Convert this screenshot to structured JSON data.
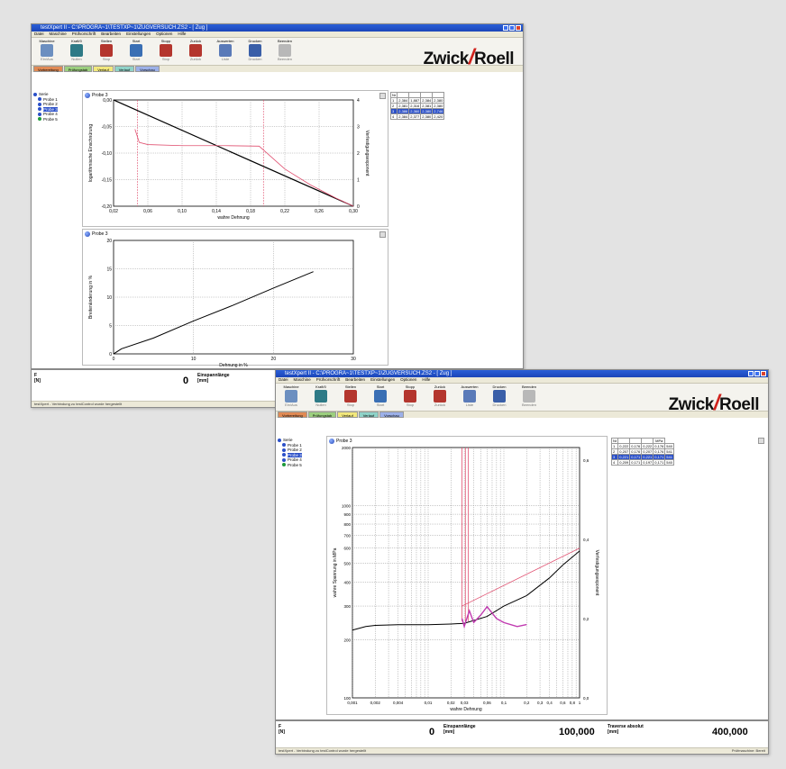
{
  "window1": {
    "title": "testXpert II - C:\\PROGRA~1\\TESTXP~1\\ZUGVERSUCH.ZS2 - [ Zug ]",
    "menu": [
      "Datei",
      "Maschine",
      "Prüfvorschrift",
      "Bearbeiten",
      "Einstellungen",
      "Optionen",
      "Hilfe"
    ],
    "toolbar": [
      {
        "label": "Maschine",
        "caption": "Ein/Aus",
        "color": "#6c8fc0"
      },
      {
        "label": "Kraft/0",
        "caption": "Nullen",
        "color": "#2e7a86"
      },
      {
        "label": "Stellen",
        "caption": "Stop",
        "color": "#b4362e"
      },
      {
        "label": "Start",
        "caption": "Start",
        "color": "#3a6fb4"
      },
      {
        "label": "Stopp",
        "caption": "Stop",
        "color": "#b4362e"
      },
      {
        "label": "Zurück",
        "caption": "Zurück",
        "color": "#b4362e"
      },
      {
        "label": "Auswerten",
        "caption": "Liste",
        "color": "#5a7ab8"
      },
      {
        "label": "Drucken",
        "caption": "Drucken",
        "color": "#3a5fa8"
      },
      {
        "label": "Beenden",
        "caption": "Beenden",
        "color": "#b8b8b8"
      }
    ],
    "logo": {
      "left": "Zwick",
      "right": "Roell"
    },
    "tabs": [
      {
        "label": "Vorbereitung",
        "color": "#e08a54"
      },
      {
        "label": "Prüfungstab",
        "color": "#9ccf7e"
      },
      {
        "label": "Verlauf",
        "color": "#f2e87c"
      },
      {
        "label": "Verlauf",
        "color": "#8fd3c8"
      },
      {
        "label": "Vorschau",
        "color": "#9cb0e8"
      }
    ],
    "tree": {
      "root": "Serie",
      "items": [
        "Probe 1",
        "Probe 2",
        "Probe 3",
        "Probe 4",
        "Probe 5"
      ],
      "selected_index": 2
    },
    "chart1": {
      "title": "Probe 3",
      "xlabel": "wahre Dehnung",
      "ylabel_left": "logarithmische Einschnürung",
      "ylabel_right": "Verfestigungsexponent"
    },
    "chart2": {
      "title": "Probe 3",
      "xlabel": "Dehnung in %",
      "ylabel": "Breitenänderung in %"
    },
    "table": {
      "headers": [
        "Nr",
        "",
        "",
        "",
        ""
      ],
      "rows": [
        [
          "1",
          "2,384",
          "1,887",
          "2,384",
          "2,380"
        ],
        [
          "2",
          "2,381",
          "2,316",
          "2,381",
          "2,380"
        ],
        [
          "3",
          "2,386",
          "2,360",
          "2,380",
          "2,746"
        ],
        [
          "4",
          "2,384",
          "2,377",
          "2,380",
          "2,420"
        ]
      ],
      "highlight_index": 2
    },
    "readout": {
      "label_f": "F",
      "unit_f": "[N]",
      "value_f": "0",
      "label_e": "Einspannlänge",
      "unit_e": "[mm]"
    },
    "status": "testXpert - Verbindung zu testControl wurde hergestellt"
  },
  "window2": {
    "title": "testXpert II - C:\\PROGRA~1\\TESTXP~1\\ZUGVERSUCH.ZS2 - [ Zug ]",
    "menu": [
      "Datei",
      "Maschine",
      "Prüfvorschrift",
      "Bearbeiten",
      "Einstellungen",
      "Optionen",
      "Hilfe"
    ],
    "tree": {
      "root": "Serie",
      "items": [
        "Probe 1",
        "Probe 2",
        "Probe 3",
        "Probe 4",
        "Probe 5"
      ],
      "selected_index": 2
    },
    "chart": {
      "title": "Probe 3",
      "xlabel": "wahre Dehnung",
      "ylabel_left": "wahre Spannung in MPa",
      "ylabel_right": "Verfestigungsexponent"
    },
    "table": {
      "headers": [
        "Nr",
        "",
        "",
        "",
        "MPa"
      ],
      "rows": [
        [
          "1",
          "0,222",
          "0,176",
          "0,222",
          "0,176",
          "540"
        ],
        [
          "2",
          "0,207",
          "0,176",
          "0,207",
          "0,176",
          "541"
        ],
        [
          "3",
          "0,221",
          "0,171",
          "0,221",
          "0,171",
          "541"
        ],
        [
          "4",
          "0,209",
          "0,171",
          "0,197",
          "0,171",
          "540"
        ]
      ],
      "highlight_index": 2
    },
    "readout": {
      "label_f": "F",
      "unit_f": "[N]",
      "value_f": "0",
      "label_e": "Einspannlänge",
      "unit_e": "[mm]",
      "value_e": "100,000",
      "label_t": "Traverse absolut",
      "unit_t": "[mm]",
      "value_t": "400,000"
    },
    "status": "testXpert - Verbindung zu testControl wurde hergestellt",
    "status_right": "Prüfmaschine: Bereit"
  },
  "chart_data": [
    {
      "type": "line",
      "title": "Probe 3",
      "xlabel": "wahre Dehnung",
      "ylabel": "logarithmische Einschnürung",
      "xlim": [
        0.02,
        0.3
      ],
      "ylim": [
        -0.2,
        0.0
      ],
      "xticks": [
        "0,02",
        "0,06",
        "0,10",
        "0,14",
        "0,18",
        "0,22",
        "0,26",
        "0,30"
      ],
      "yticks": [
        "0,00",
        "-0,05",
        "-0,10",
        "-0,15",
        "-0,20"
      ],
      "y2lim": [
        0,
        4
      ],
      "y2ticks": [
        "0",
        "1",
        "2",
        "3",
        "4"
      ],
      "series": [
        {
          "x": [
            0.02,
            0.3
          ],
          "y": [
            0.0,
            -0.2
          ],
          "color": "#000000"
        },
        {
          "x": [
            0.045,
            0.05,
            0.06,
            0.1,
            0.15,
            0.19,
            0.22,
            0.25,
            0.28,
            0.3
          ],
          "y": [
            -0.055,
            -0.08,
            -0.084,
            -0.086,
            -0.086,
            -0.087,
            -0.13,
            -0.16,
            -0.185,
            -0.2
          ],
          "color": "#e05070"
        }
      ]
    },
    {
      "type": "line",
      "title": "Probe 3",
      "xlabel": "Dehnung in %",
      "ylabel": "Breitenänderung in %",
      "xlim": [
        0,
        30
      ],
      "ylim": [
        0,
        20
      ],
      "xticks": [
        "0",
        "10",
        "20",
        "30"
      ],
      "yticks": [
        "0",
        "5",
        "10",
        "15",
        "20"
      ],
      "series": [
        {
          "x": [
            0,
            1,
            5,
            10,
            15,
            20,
            25
          ],
          "y": [
            0,
            0.9,
            2.8,
            5.8,
            8.6,
            11.6,
            14.5
          ],
          "color": "#000000"
        }
      ]
    },
    {
      "type": "line",
      "title": "Probe 3",
      "xlabel": "wahre Dehnung",
      "ylabel": "wahre Spannung in MPa",
      "xscale": "log",
      "yscale": "log",
      "xlim": [
        0.001,
        1
      ],
      "ylim": [
        100,
        2000
      ],
      "xtick_labels": [
        "0,001",
        "0,002",
        "0,004",
        "0,01",
        "0,02",
        "0,03",
        "0,06",
        "0,1",
        "0,2",
        "0,3",
        "0,4",
        "0,6",
        "0,8",
        "1"
      ],
      "ytick_labels": [
        "2000",
        "1000",
        "900",
        "800",
        "700",
        "600",
        "500",
        "400",
        "300",
        "200",
        "100"
      ],
      "y2lim": [
        0,
        0.6
      ],
      "y2ticks": [
        "0,0",
        "0,2",
        "0,4",
        "0,6"
      ],
      "series": [
        {
          "x": [
            0.001,
            0.0015,
            0.002,
            0.004,
            0.01,
            0.02,
            0.03,
            0.06,
            0.1,
            0.2,
            0.4,
            0.6,
            1
          ],
          "y": [
            225,
            235,
            238,
            240,
            240,
            242,
            244,
            265,
            300,
            340,
            420,
            490,
            580
          ],
          "color": "#000000"
        },
        {
          "x": [
            0.028,
            0.03,
            0.035,
            0.04,
            0.05,
            0.06,
            0.08,
            0.1,
            0.15,
            0.2
          ],
          "y": [
            0.2,
            0.18,
            0.22,
            0.19,
            0.21,
            0.23,
            0.2,
            0.19,
            0.18,
            0.185
          ],
          "color": "#c03ab0"
        }
      ]
    }
  ]
}
